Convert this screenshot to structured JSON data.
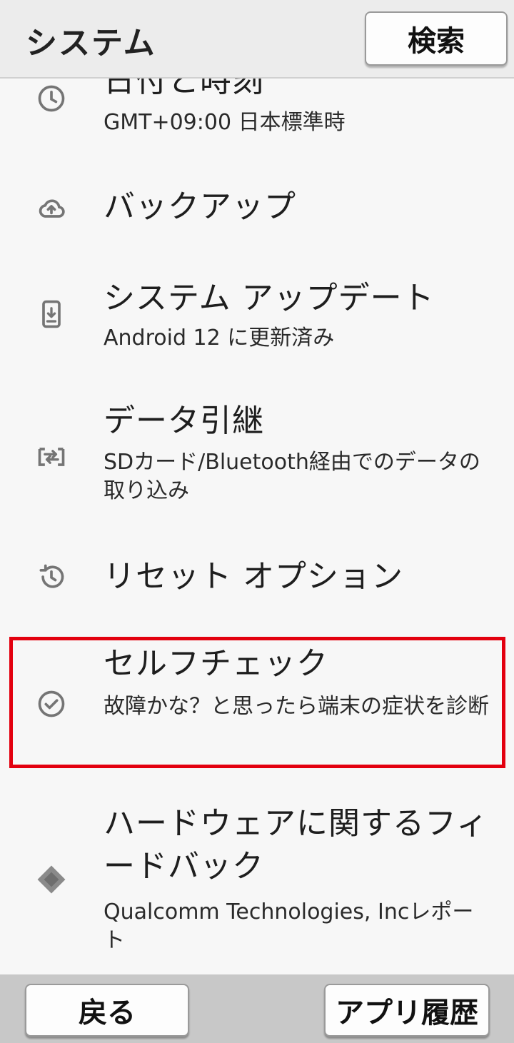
{
  "header": {
    "title": "システム",
    "search_label": "検索"
  },
  "items": [
    {
      "title": "日付と時刻",
      "subtitle": "GMT+09:00 日本標準時",
      "icon": "clock-icon"
    },
    {
      "title": "バックアップ",
      "icon": "cloud-upload-icon"
    },
    {
      "title": "システム アップデート",
      "subtitle": "Android 12 に更新済み",
      "icon": "system-update-icon"
    },
    {
      "title": "データ引継",
      "subtitle": "SDカード/Bluetooth経由でのデータの取り込み",
      "icon": "data-transfer-icon"
    },
    {
      "title": "リセット オプション",
      "icon": "history-icon"
    },
    {
      "title": "セルフチェック",
      "subtitle": "故障かな？と思ったら端末の症状を診断",
      "icon": "check-circle-icon"
    },
    {
      "title": "ハードウェアに関するフィードバック",
      "subtitle": "Qualcomm Technologies, Incレポート",
      "icon": "chip-icon"
    }
  ],
  "footer": {
    "back_label": "戻る",
    "recent_label": "アプリ履歴"
  },
  "colors": {
    "highlight": "#e3000f",
    "icon": "#757575"
  }
}
